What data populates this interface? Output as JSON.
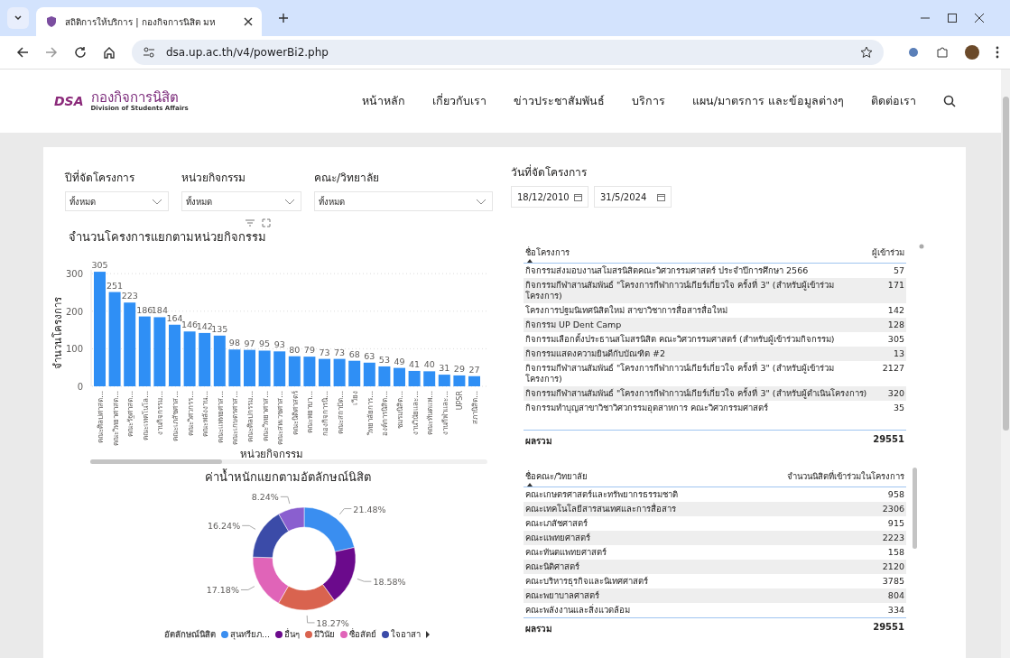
{
  "browser": {
    "tab_title": "สถิติการให้บริการ | กองกิจการนิสิต มห",
    "url": "dsa.up.ac.th/v4/powerBi2.php"
  },
  "site": {
    "logo_text": "DSA",
    "name": "กองกิจการนิสิต",
    "subtitle": "Division of Students Affairs",
    "nav": [
      "หน้าหลัก",
      "เกี่ยวกับเรา",
      "ข่าวประชาสัมพันธ์",
      "บริการ",
      "แผน/มาตรการ และข้อมูลต่างๆ",
      "ติดต่อเรา"
    ]
  },
  "slicers": [
    {
      "label": "ปีที่จัดโครงการ",
      "value": "ทั้งหมด"
    },
    {
      "label": "หน่วยกิจกรรม",
      "value": "ทั้งหมด"
    },
    {
      "label": "คณะ/วิทยาลัย",
      "value": "ทั้งหมด"
    }
  ],
  "date_slicer": {
    "label": "วันที่จัดโครงการ",
    "from": "18/12/2010",
    "to": "31/5/2024"
  },
  "bar_chart": {
    "chart_data": {
      "type": "bar",
      "title": "จำนวนโครงการแยกตามหน่วยกิจกรรม",
      "xlabel": "หน่วยกิจกรรม",
      "ylabel": "จำนวนโครงการ",
      "grid": true,
      "ylim": [
        0,
        310
      ],
      "yticks": [
        0,
        100,
        200,
        300
      ],
      "data_labels": true,
      "categories": [
        "คณะศิลปศาสต...",
        "คณะวิทยาศาสต...",
        "คณะรัฐศาสต...",
        "คณะเทคโนโล...",
        "งานกิจกรรม...",
        "คณะเภสัชศาส...",
        "คณะวิศวกรร...",
        "คณะพลังงาน...",
        "คณะแพทยศาส...",
        "คณะเกษตรศาส...",
        "คณะศิลปกรรม...",
        "คณะวิทยาศาส...",
        "คณะสหเวชศาส...",
        "คณะนิติศาสตร์",
        "คณะพยาบา...",
        "กองกิจการนิ...",
        "คณะสถาปัต...",
        "เวียง",
        "วิทยาลัยการ...",
        "องค์การนิสิต...",
        "ชมรมนิสิต...",
        "งานวินัยและ...",
        "คณะทันตแพ...",
        "งานกีฬาและ...",
        "UPSR",
        "สภานิสิต..."
      ],
      "values": [
        305,
        251,
        223,
        186,
        184,
        164,
        146,
        142,
        135,
        98,
        97,
        95,
        93,
        80,
        79,
        73,
        73,
        68,
        63,
        53,
        49,
        41,
        40,
        31,
        29,
        27
      ]
    }
  },
  "projects_table": {
    "columns": [
      "ชื่อโครงการ",
      "ผู้เข้าร่วม"
    ],
    "rows": [
      [
        "กิจกรรมส่งมอบงานสโมสรนิสิตคณะวิศวกรรมศาสตร์ ประจำปีการศึกษา 2566",
        "57"
      ],
      [
        "กิจกรรมกีฬาสานสัมพันธ์ \"โครงการกีฬากาวน์เกียร์เกี่ยวใจ ครั้งที่ 3\" (สำหรับผู้เข้าร่วมโครงการ)",
        "171"
      ],
      [
        "โครงการปฐมนิเทศนิสิตใหม่ สาขาวิชาการสื่อสารสื่อใหม่",
        "142"
      ],
      [
        "กิจกรรม UP Dent Camp",
        "128"
      ],
      [
        "กิจกรรมเลือกตั้งประธานสโมสรนิสิต คณะวิศวกรรมศาสตร์ (สำหรับผู้เข้าร่วมกิจกรรม)",
        "305"
      ],
      [
        "กิจกรรมแสดงความยินดีกับบัณฑิต #2",
        "13"
      ],
      [
        "กิจกรรมกีฬาสานสัมพันธ์ \"โครงการกีฬากาวน์เกียร์เกี่ยวใจ ครั้งที่ 3\" (สำหรับผู้เข้าร่วมโครงการ)",
        "2127"
      ],
      [
        "กิจกรรมกีฬาสานสัมพันธ์ \"โครงการกีฬากาวน์เกียร์เกี่ยวใจ ครั้งที่ 3\" (สำหรับผู้ดำเนินโครงการ)",
        "320"
      ],
      [
        "กิจกรรมทำบุญสาขาวิชาวิศวกรรมอุตสาหการ คณะวิศวกรรมศาสตร์",
        "35"
      ]
    ],
    "total_label": "ผลรวม",
    "total": "29551"
  },
  "donut_chart": {
    "chart_data": {
      "type": "donut",
      "title": "ค่าน้ำหนักแยกตามอัตลักษณ์นิสิต",
      "values": [
        21.48,
        18.58,
        18.27,
        17.18,
        16.24,
        8.24
      ],
      "value_labels": [
        "21.48%",
        "18.58%",
        "18.27%",
        "17.18%",
        "16.24%",
        "8.24%"
      ]
    },
    "legend": {
      "title": "อัตลักษณ์นิสิต",
      "items": [
        {
          "label": "สุนทรียภ...",
          "color": "#3a8ef0"
        },
        {
          "label": "อื่นๆ",
          "color": "#6b0a8c"
        },
        {
          "label": "มีวินัย",
          "color": "#d9634f"
        },
        {
          "label": "ซื่อสัตย์",
          "color": "#e064b8"
        },
        {
          "label": "ใจอาสา",
          "color": "#3b4ba8"
        }
      ]
    }
  },
  "faculty_table": {
    "columns": [
      "ชื่อคณะ/วิทยาลัย",
      "จำนวนนิสิตที่เข้าร่วมในโครงการ"
    ],
    "rows": [
      [
        "คณะเกษตรศาสตร์และทรัพยากรธรรมชาติ",
        "958"
      ],
      [
        "คณะเทคโนโลยีสารสนเทศและการสื่อสาร",
        "2306"
      ],
      [
        "คณะเภสัชศาสตร์",
        "915"
      ],
      [
        "คณะแพทยศาสตร์",
        "2223"
      ],
      [
        "คณะทันตแพทยศาสตร์",
        "158"
      ],
      [
        "คณะนิติศาสตร์",
        "2120"
      ],
      [
        "คณะบริหารธุรกิจและนิเทศศาสตร์",
        "3785"
      ],
      [
        "คณะพยาบาลศาสตร์",
        "804"
      ],
      [
        "คณะพลังงานและสิ่งแวดล้อม",
        "334"
      ]
    ],
    "total_label": "ผลรวม",
    "total": "29551"
  }
}
